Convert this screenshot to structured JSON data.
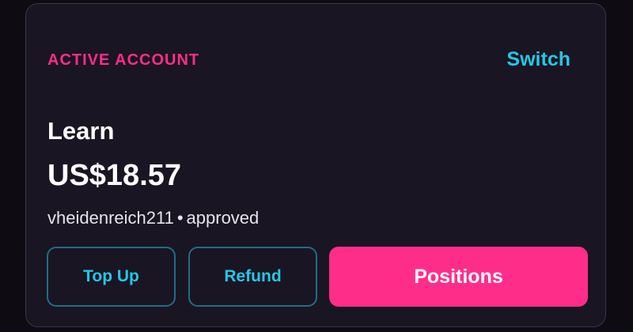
{
  "account": {
    "section_label": "ACTIVE ACCOUNT",
    "switch_label": "Switch",
    "name": "Learn",
    "balance": "US$18.57",
    "username": "vheidenreich211",
    "separator": "•",
    "status": "approved"
  },
  "actions": {
    "top_up_label": "Top Up",
    "refund_label": "Refund",
    "positions_label": "Positions"
  },
  "colors": {
    "background": "#0e0b13",
    "card": "#1a1523",
    "accent_pink": "#ff2d8a",
    "accent_cyan": "#25c7e6"
  }
}
